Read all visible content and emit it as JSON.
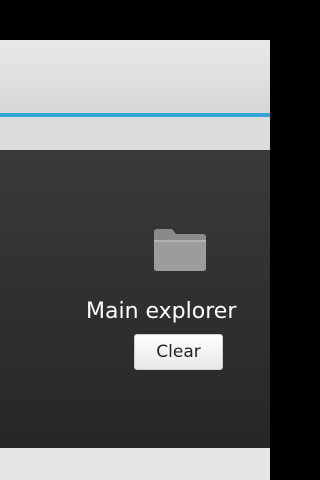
{
  "app": {
    "action_bar_title": "",
    "accent_color": "#33a5d0"
  },
  "explorer": {
    "icon": "folder-icon",
    "title": "Main explorer",
    "clear_label": "Clear"
  }
}
